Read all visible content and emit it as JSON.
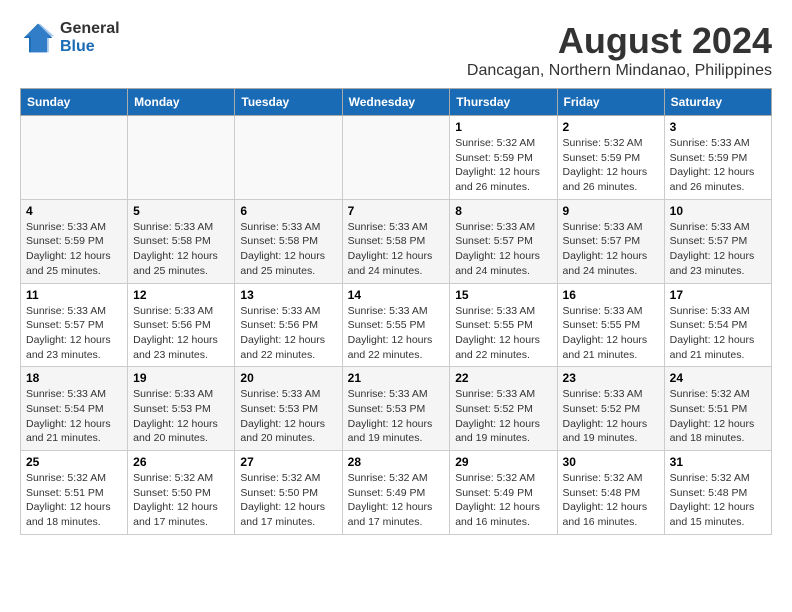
{
  "logo": {
    "general": "General",
    "blue": "Blue"
  },
  "title": {
    "month_year": "August 2024",
    "location": "Dancagan, Northern Mindanao, Philippines"
  },
  "weekdays": [
    "Sunday",
    "Monday",
    "Tuesday",
    "Wednesday",
    "Thursday",
    "Friday",
    "Saturday"
  ],
  "weeks": [
    [
      {
        "day": "",
        "info": ""
      },
      {
        "day": "",
        "info": ""
      },
      {
        "day": "",
        "info": ""
      },
      {
        "day": "",
        "info": ""
      },
      {
        "day": "1",
        "info": "Sunrise: 5:32 AM\nSunset: 5:59 PM\nDaylight: 12 hours\nand 26 minutes."
      },
      {
        "day": "2",
        "info": "Sunrise: 5:32 AM\nSunset: 5:59 PM\nDaylight: 12 hours\nand 26 minutes."
      },
      {
        "day": "3",
        "info": "Sunrise: 5:33 AM\nSunset: 5:59 PM\nDaylight: 12 hours\nand 26 minutes."
      }
    ],
    [
      {
        "day": "4",
        "info": "Sunrise: 5:33 AM\nSunset: 5:59 PM\nDaylight: 12 hours\nand 25 minutes."
      },
      {
        "day": "5",
        "info": "Sunrise: 5:33 AM\nSunset: 5:58 PM\nDaylight: 12 hours\nand 25 minutes."
      },
      {
        "day": "6",
        "info": "Sunrise: 5:33 AM\nSunset: 5:58 PM\nDaylight: 12 hours\nand 25 minutes."
      },
      {
        "day": "7",
        "info": "Sunrise: 5:33 AM\nSunset: 5:58 PM\nDaylight: 12 hours\nand 24 minutes."
      },
      {
        "day": "8",
        "info": "Sunrise: 5:33 AM\nSunset: 5:57 PM\nDaylight: 12 hours\nand 24 minutes."
      },
      {
        "day": "9",
        "info": "Sunrise: 5:33 AM\nSunset: 5:57 PM\nDaylight: 12 hours\nand 24 minutes."
      },
      {
        "day": "10",
        "info": "Sunrise: 5:33 AM\nSunset: 5:57 PM\nDaylight: 12 hours\nand 23 minutes."
      }
    ],
    [
      {
        "day": "11",
        "info": "Sunrise: 5:33 AM\nSunset: 5:57 PM\nDaylight: 12 hours\nand 23 minutes."
      },
      {
        "day": "12",
        "info": "Sunrise: 5:33 AM\nSunset: 5:56 PM\nDaylight: 12 hours\nand 23 minutes."
      },
      {
        "day": "13",
        "info": "Sunrise: 5:33 AM\nSunset: 5:56 PM\nDaylight: 12 hours\nand 22 minutes."
      },
      {
        "day": "14",
        "info": "Sunrise: 5:33 AM\nSunset: 5:55 PM\nDaylight: 12 hours\nand 22 minutes."
      },
      {
        "day": "15",
        "info": "Sunrise: 5:33 AM\nSunset: 5:55 PM\nDaylight: 12 hours\nand 22 minutes."
      },
      {
        "day": "16",
        "info": "Sunrise: 5:33 AM\nSunset: 5:55 PM\nDaylight: 12 hours\nand 21 minutes."
      },
      {
        "day": "17",
        "info": "Sunrise: 5:33 AM\nSunset: 5:54 PM\nDaylight: 12 hours\nand 21 minutes."
      }
    ],
    [
      {
        "day": "18",
        "info": "Sunrise: 5:33 AM\nSunset: 5:54 PM\nDaylight: 12 hours\nand 21 minutes."
      },
      {
        "day": "19",
        "info": "Sunrise: 5:33 AM\nSunset: 5:53 PM\nDaylight: 12 hours\nand 20 minutes."
      },
      {
        "day": "20",
        "info": "Sunrise: 5:33 AM\nSunset: 5:53 PM\nDaylight: 12 hours\nand 20 minutes."
      },
      {
        "day": "21",
        "info": "Sunrise: 5:33 AM\nSunset: 5:53 PM\nDaylight: 12 hours\nand 19 minutes."
      },
      {
        "day": "22",
        "info": "Sunrise: 5:33 AM\nSunset: 5:52 PM\nDaylight: 12 hours\nand 19 minutes."
      },
      {
        "day": "23",
        "info": "Sunrise: 5:33 AM\nSunset: 5:52 PM\nDaylight: 12 hours\nand 19 minutes."
      },
      {
        "day": "24",
        "info": "Sunrise: 5:32 AM\nSunset: 5:51 PM\nDaylight: 12 hours\nand 18 minutes."
      }
    ],
    [
      {
        "day": "25",
        "info": "Sunrise: 5:32 AM\nSunset: 5:51 PM\nDaylight: 12 hours\nand 18 minutes."
      },
      {
        "day": "26",
        "info": "Sunrise: 5:32 AM\nSunset: 5:50 PM\nDaylight: 12 hours\nand 17 minutes."
      },
      {
        "day": "27",
        "info": "Sunrise: 5:32 AM\nSunset: 5:50 PM\nDaylight: 12 hours\nand 17 minutes."
      },
      {
        "day": "28",
        "info": "Sunrise: 5:32 AM\nSunset: 5:49 PM\nDaylight: 12 hours\nand 17 minutes."
      },
      {
        "day": "29",
        "info": "Sunrise: 5:32 AM\nSunset: 5:49 PM\nDaylight: 12 hours\nand 16 minutes."
      },
      {
        "day": "30",
        "info": "Sunrise: 5:32 AM\nSunset: 5:48 PM\nDaylight: 12 hours\nand 16 minutes."
      },
      {
        "day": "31",
        "info": "Sunrise: 5:32 AM\nSunset: 5:48 PM\nDaylight: 12 hours\nand 15 minutes."
      }
    ]
  ]
}
